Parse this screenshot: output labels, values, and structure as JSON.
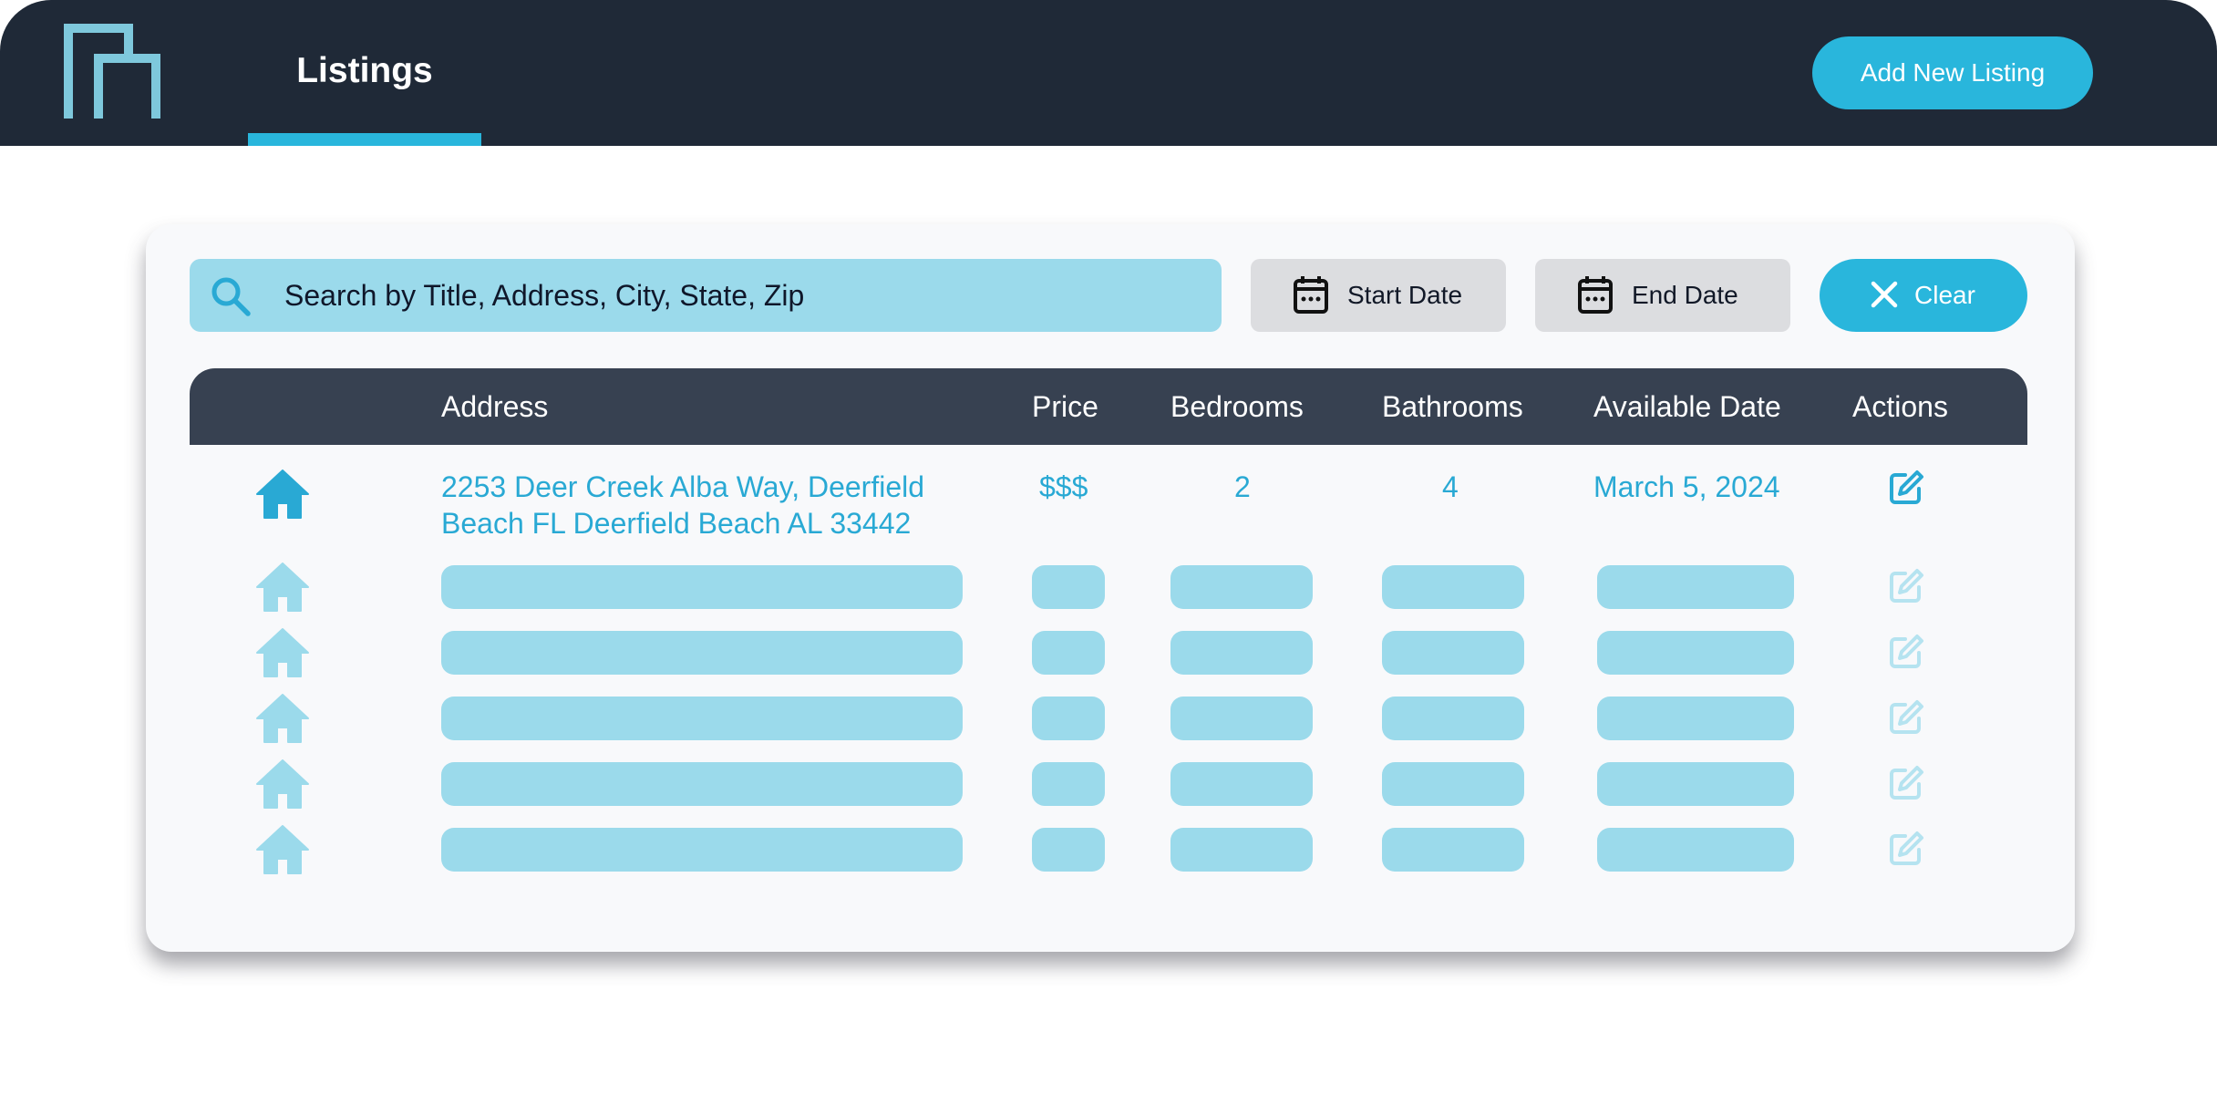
{
  "header": {
    "tab_label": "Listings",
    "add_button_label": "Add New Listing"
  },
  "toolbar": {
    "search_placeholder": "Search by Title, Address, City, State, Zip",
    "start_date_label": "Start Date",
    "end_date_label": "End Date",
    "clear_label": "Clear"
  },
  "table": {
    "columns": [
      "Address",
      "Price",
      "Bedrooms",
      "Bathrooms",
      "Available Date",
      "Actions"
    ],
    "rows": [
      {
        "address_line1": "2253 Deer Creek Alba Way, Deerfield",
        "address_line2": "Beach FL Deerfield Beach AL 33442",
        "price": "$$$",
        "bedrooms": "2",
        "bathrooms": "4",
        "available_date": "March 5, 2024"
      }
    ],
    "placeholder_rows": 5
  },
  "colors": {
    "accent": "#29b6dc",
    "header_bg": "#1f2937",
    "table_header_bg": "#374151",
    "skeleton": "#9bdaeb"
  },
  "icons": [
    "logo-icon",
    "search-icon",
    "calendar-icon",
    "close-icon",
    "home-icon",
    "edit-icon"
  ]
}
